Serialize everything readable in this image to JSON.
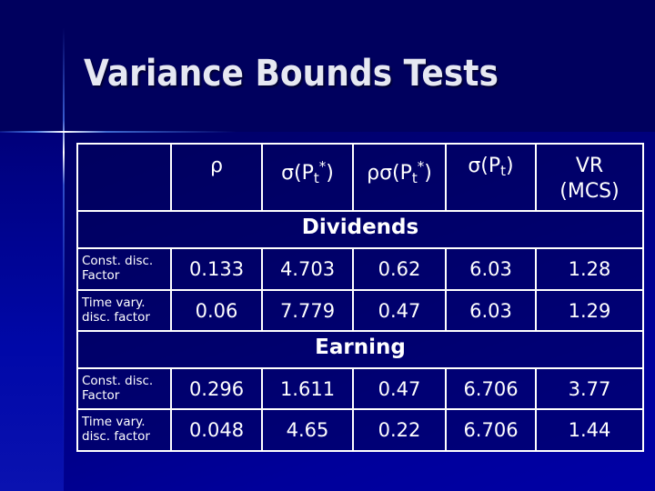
{
  "slide": {
    "title": "Variance Bounds Tests"
  },
  "table": {
    "headers": [
      {
        "base": "",
        "sub": "",
        "sup": "",
        "tail": ""
      },
      {
        "base": "ρ",
        "sub": "",
        "sup": "",
        "tail": ""
      },
      {
        "base": "σ(P",
        "sub": "t",
        "sup": "*",
        "tail": ")"
      },
      {
        "base": "ρσ(P",
        "sub": "t",
        "sup": "*",
        "tail": ")"
      },
      {
        "base": "σ(P",
        "sub": "t",
        "sup": "",
        "tail": ")"
      },
      {
        "base": "VR",
        "line2": "(MCS)"
      }
    ],
    "sections": [
      {
        "name": "Dividends",
        "rows": [
          {
            "label_line1": "Const. disc.",
            "label_line2": "Factor",
            "values": [
              "0.133",
              "4.703",
              "0.62",
              "6.03",
              "1.28"
            ]
          },
          {
            "label_line1": "Time vary.",
            "label_line2": "disc. factor",
            "values": [
              "0.06",
              "7.779",
              "0.47",
              "6.03",
              "1.29"
            ]
          }
        ]
      },
      {
        "name": "Earning",
        "rows": [
          {
            "label_line1": "Const. disc.",
            "label_line2": "Factor",
            "values": [
              "0.296",
              "1.611",
              "0.47",
              "6.706",
              "3.77"
            ]
          },
          {
            "label_line1": "Time vary.",
            "label_line2": "disc. factor",
            "values": [
              "0.048",
              "4.65",
              "0.22",
              "6.706",
              "1.44"
            ]
          }
        ]
      }
    ]
  },
  "colors": {
    "background_top": "#00005e",
    "background_bottom": "#0000a6",
    "title": "#e6e8f2",
    "grid": "#ffffff"
  }
}
